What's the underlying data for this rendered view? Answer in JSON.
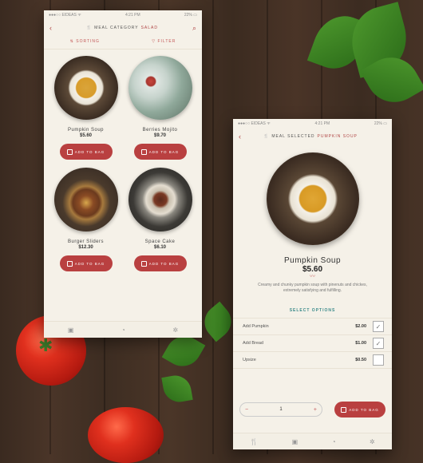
{
  "phone1": {
    "status": {
      "carrier": "●●●○○ EIDEAS ᯤ",
      "time": "4:21 PM",
      "battery": "22% ▭"
    },
    "nav": {
      "title_prefix": "MEAL CATEGORY",
      "title_accent": "SALAD"
    },
    "filters": {
      "sorting": "SORTING",
      "filter": "FILTER"
    },
    "items": [
      {
        "name": "Pumpkin Soup",
        "price": "$5.60",
        "button": "ADD TO BAG"
      },
      {
        "name": "Berries Mojito",
        "price": "$9.70",
        "button": "ADD TO BAG"
      },
      {
        "name": "Burger Sliders",
        "price": "$12.30",
        "button": "ADD TO BAG"
      },
      {
        "name": "Space Cake",
        "price": "$6.10",
        "button": "ADD TO BAG"
      }
    ]
  },
  "phone2": {
    "status": {
      "carrier": "●●●○○ EIDEAS ᯤ",
      "time": "4:21 PM",
      "battery": "22% ▭"
    },
    "nav": {
      "title_prefix": "MEAL SELECTED",
      "title_accent": "PUMPKIN SOUP"
    },
    "product": {
      "name": "Pumpkin Soup",
      "price": "$5.60",
      "description": "Creamy and chunky pumpkin soup with pinenuts and chickes, extremely satisfying and fulfilling."
    },
    "options_title": "SELECT OPTIONS",
    "options": [
      {
        "label": "Add Pumpkin",
        "price": "$2.00",
        "checked": "✓"
      },
      {
        "label": "Add Bread",
        "price": "$1.00",
        "checked": "✓"
      },
      {
        "label": "Upsize",
        "price": "$0.50",
        "checked": ""
      }
    ],
    "quantity": "1",
    "add_button": "ADD TO BAG"
  },
  "colors": {
    "accent": "#b94040",
    "teal": "#3a8a8a",
    "background": "#f5f1e8"
  }
}
